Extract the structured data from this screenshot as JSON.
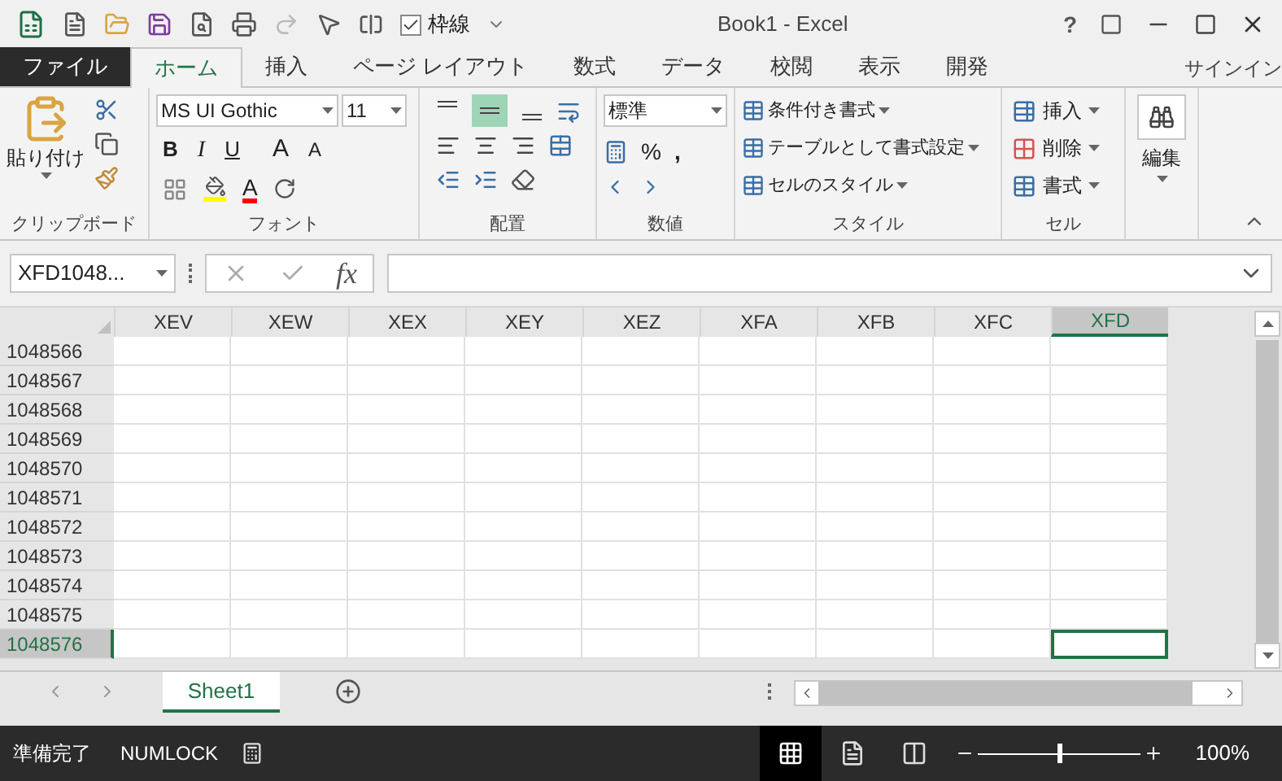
{
  "title_bar": {
    "gridlines_checkbox": {
      "label": "枠線",
      "checked": true
    },
    "title": "Book1 - Excel",
    "help": "?"
  },
  "ribbon_tabs": [
    {
      "label": "ファイル",
      "kind": "file",
      "selected": false
    },
    {
      "label": "ホーム",
      "kind": "tab",
      "selected": true
    },
    {
      "label": "挿入",
      "kind": "tab",
      "selected": false
    },
    {
      "label": "ページ レイアウト",
      "kind": "tab",
      "selected": false
    },
    {
      "label": "数式",
      "kind": "tab",
      "selected": false
    },
    {
      "label": "データ",
      "kind": "tab",
      "selected": false
    },
    {
      "label": "校閲",
      "kind": "tab",
      "selected": false
    },
    {
      "label": "表示",
      "kind": "tab",
      "selected": false
    },
    {
      "label": "開発",
      "kind": "tab",
      "selected": false
    }
  ],
  "sign_in": "サインイン",
  "clipboard": {
    "paste": "貼り付け",
    "label": "クリップボード"
  },
  "font": {
    "name": "MS UI Gothic",
    "size": "11",
    "bold": "B",
    "italic": "I",
    "underline": "U",
    "grow": "A",
    "shrink": "A",
    "text_color_button": "A",
    "label": "フォント"
  },
  "alignment": {
    "vertical": [
      {
        "kind": "top",
        "selected": false
      },
      {
        "kind": "middle",
        "selected": true
      },
      {
        "kind": "bottom",
        "selected": false
      }
    ],
    "label": "配置"
  },
  "number": {
    "format": "標準",
    "percent": "%",
    "comma": ",",
    "label": "数値"
  },
  "styles": {
    "items": [
      "条件付き書式",
      "テーブルとして書式設定",
      "セルのスタイル"
    ],
    "label": "スタイル"
  },
  "cells": {
    "items": [
      {
        "kind": "insert",
        "label": "挿入"
      },
      {
        "kind": "delete",
        "label": "削除"
      },
      {
        "kind": "format",
        "label": "書式"
      }
    ],
    "label": "セル"
  },
  "editing": {
    "label": "編集"
  },
  "formula_bar": {
    "name_box": "XFD1048...",
    "fx": "fx"
  },
  "columns": [
    {
      "label": "XEV",
      "selected": false
    },
    {
      "label": "XEW",
      "selected": false
    },
    {
      "label": "XEX",
      "selected": false
    },
    {
      "label": "XEY",
      "selected": false
    },
    {
      "label": "XEZ",
      "selected": false
    },
    {
      "label": "XFA",
      "selected": false
    },
    {
      "label": "XFB",
      "selected": false
    },
    {
      "label": "XFC",
      "selected": false
    },
    {
      "label": "XFD",
      "selected": true
    }
  ],
  "rows": [
    {
      "label": "1048566",
      "selected": false
    },
    {
      "label": "1048567",
      "selected": false
    },
    {
      "label": "1048568",
      "selected": false
    },
    {
      "label": "1048569",
      "selected": false
    },
    {
      "label": "1048570",
      "selected": false
    },
    {
      "label": "1048571",
      "selected": false
    },
    {
      "label": "1048572",
      "selected": false
    },
    {
      "label": "1048573",
      "selected": false
    },
    {
      "label": "1048574",
      "selected": false
    },
    {
      "label": "1048575",
      "selected": false
    },
    {
      "label": "1048576",
      "selected": true
    }
  ],
  "sheet_tabs": [
    {
      "label": "Sheet1",
      "selected": true
    }
  ],
  "status_bar": {
    "ready": "準備完了",
    "numlock": "NUMLOCK",
    "views": [
      {
        "kind": "normal",
        "selected": true
      },
      {
        "kind": "page-layout",
        "selected": false
      },
      {
        "kind": "page-break",
        "selected": false
      }
    ],
    "zoom": {
      "level": 0.5
    },
    "zoom_text": "100%"
  }
}
